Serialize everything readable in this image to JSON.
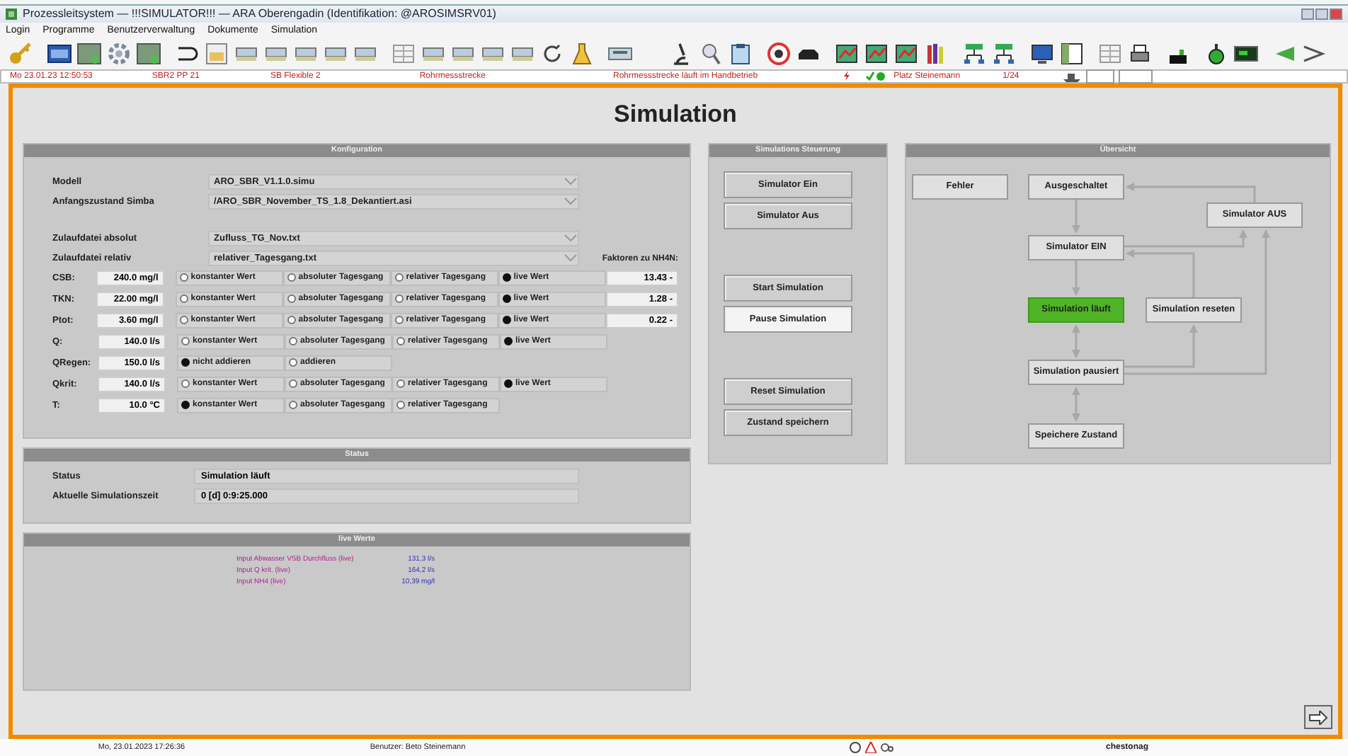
{
  "window": {
    "title": "Prozessleitsystem — !!!SIMULATOR!!! — ARA Oberengadin (Identifikation: @AROSIMSRV01)"
  },
  "menu": [
    {
      "label": "Login"
    },
    {
      "label": "Programme"
    },
    {
      "label": "Benutzerverwaltung"
    },
    {
      "label": "Dokumente"
    },
    {
      "label": "Simulation"
    }
  ],
  "info_strip": {
    "left": [
      "Mo 23.01.23 12:50:53",
      "SBR2 PP 21",
      "SB Flexible 2",
      "Rohrmessstrecke",
      "Rohrmessstrecke läuft im Handbetrieb"
    ],
    "right": [
      "Platz Steinemann",
      "1/24"
    ]
  },
  "page_title": "Simulation",
  "configuration": {
    "title": "Konfiguration",
    "file_groups": [
      [
        {
          "label": "Modell",
          "value": "ARO_SBR_V1.1.0.simu"
        },
        {
          "label": "Anfangszustand Simba",
          "value": "/ARO_SBR_November_TS_1.8_Dekantiert.asi"
        }
      ],
      [
        {
          "label": "Zulaufdatei absolut",
          "value": "Zufluss_TG_Nov.txt"
        },
        {
          "label": "Zulaufdatei relativ",
          "value": "relativer_Tagesgang.txt"
        }
      ]
    ],
    "factors_heading": "Faktoren zu NH4N:",
    "parameters": [
      {
        "label": "CSB:",
        "value": "240.0 mg/l",
        "factor": "13.43 -",
        "options": [
          {
            "label": "konstanter Wert",
            "selected": false
          },
          {
            "label": "absoluter Tagesgang",
            "selected": false
          },
          {
            "label": "relativer Tagesgang",
            "selected": false
          },
          {
            "label": "live Wert",
            "selected": true
          }
        ]
      },
      {
        "label": "TKN:",
        "value": "22.00 mg/l",
        "factor": "1.28 -",
        "options": [
          {
            "label": "konstanter Wert",
            "selected": false
          },
          {
            "label": "absoluter Tagesgang",
            "selected": false
          },
          {
            "label": "relativer Tagesgang",
            "selected": false
          },
          {
            "label": "live Wert",
            "selected": true
          }
        ]
      },
      {
        "label": "Ptot:",
        "value": "3.60 mg/l",
        "factor": "0.22 -",
        "options": [
          {
            "label": "konstanter Wert",
            "selected": false
          },
          {
            "label": "absoluter Tagesgang",
            "selected": false
          },
          {
            "label": "relativer Tagesgang",
            "selected": false
          },
          {
            "label": "live Wert",
            "selected": true
          }
        ]
      },
      {
        "label": "Q:",
        "value": "140.0 l/s",
        "options": [
          {
            "label": "konstanter Wert",
            "selected": false
          },
          {
            "label": "absoluter Tagesgang",
            "selected": false
          },
          {
            "label": "relativer Tagesgang",
            "selected": false
          },
          {
            "label": "live Wert",
            "selected": true
          }
        ]
      },
      {
        "label": "QRegen:",
        "value": "150.0 l/s",
        "options": [
          {
            "label": "nicht addieren",
            "selected": true
          },
          {
            "label": "addieren",
            "selected": false
          }
        ]
      },
      {
        "label": "Qkrit:",
        "value": "140.0 l/s",
        "options": [
          {
            "label": "konstanter Wert",
            "selected": false
          },
          {
            "label": "absoluter Tagesgang",
            "selected": false
          },
          {
            "label": "relativer Tagesgang",
            "selected": false
          },
          {
            "label": "live Wert",
            "selected": true
          }
        ]
      },
      {
        "label": "T:",
        "value": "10.0 °C",
        "options": [
          {
            "label": "konstanter Wert",
            "selected": true
          },
          {
            "label": "absoluter Tagesgang",
            "selected": false
          },
          {
            "label": "relativer Tagesgang",
            "selected": false
          }
        ]
      }
    ]
  },
  "status": {
    "title": "Status",
    "rows": [
      {
        "label": "Status",
        "value": "Simulation läuft"
      },
      {
        "label": "Aktuelle Simulationszeit",
        "value": "0 [d] 0:9:25.000"
      }
    ]
  },
  "live_values": {
    "title": "live Werte",
    "rows": [
      {
        "label": "Input Abwasser VSB Durchfluss (live)",
        "value": "131,3 l/s"
      },
      {
        "label": "Input Q krit. (live)",
        "value": "164,2 l/s"
      },
      {
        "label": "Input NH4 (live)",
        "value": "10,39 mg/l"
      }
    ]
  },
  "control": {
    "title": "Simulations Steuerung",
    "groups": [
      [
        {
          "label": "Simulator Ein",
          "selected": false
        },
        {
          "label": "Simulator Aus",
          "selected": false
        }
      ],
      [
        {
          "label": "Start Simulation",
          "selected": false
        },
        {
          "label": "Pause Simulation",
          "selected": true
        }
      ],
      [
        {
          "label": "Reset Simulation",
          "selected": false
        },
        {
          "label": "Zustand speichern",
          "selected": false
        }
      ]
    ]
  },
  "overview": {
    "title": "Übersicht",
    "states": [
      {
        "label": "Fehler",
        "active": false
      },
      {
        "label": "Ausgeschaltet",
        "active": false
      },
      {
        "label": "Simulator AUS",
        "active": false
      },
      {
        "label": "Simulator EIN",
        "active": false
      },
      {
        "label": "Simulation läuft",
        "active": true
      },
      {
        "label": "Simulation reseten",
        "active": false
      },
      {
        "label": "Simulation pausiert",
        "active": false
      },
      {
        "label": "Speichere Zustand",
        "active": false
      }
    ]
  },
  "status_bar": {
    "date": "Mo, 23.01.2023 17:26:36",
    "user": "Benutzer: Beto Steinemann",
    "brand": "chestonag"
  }
}
